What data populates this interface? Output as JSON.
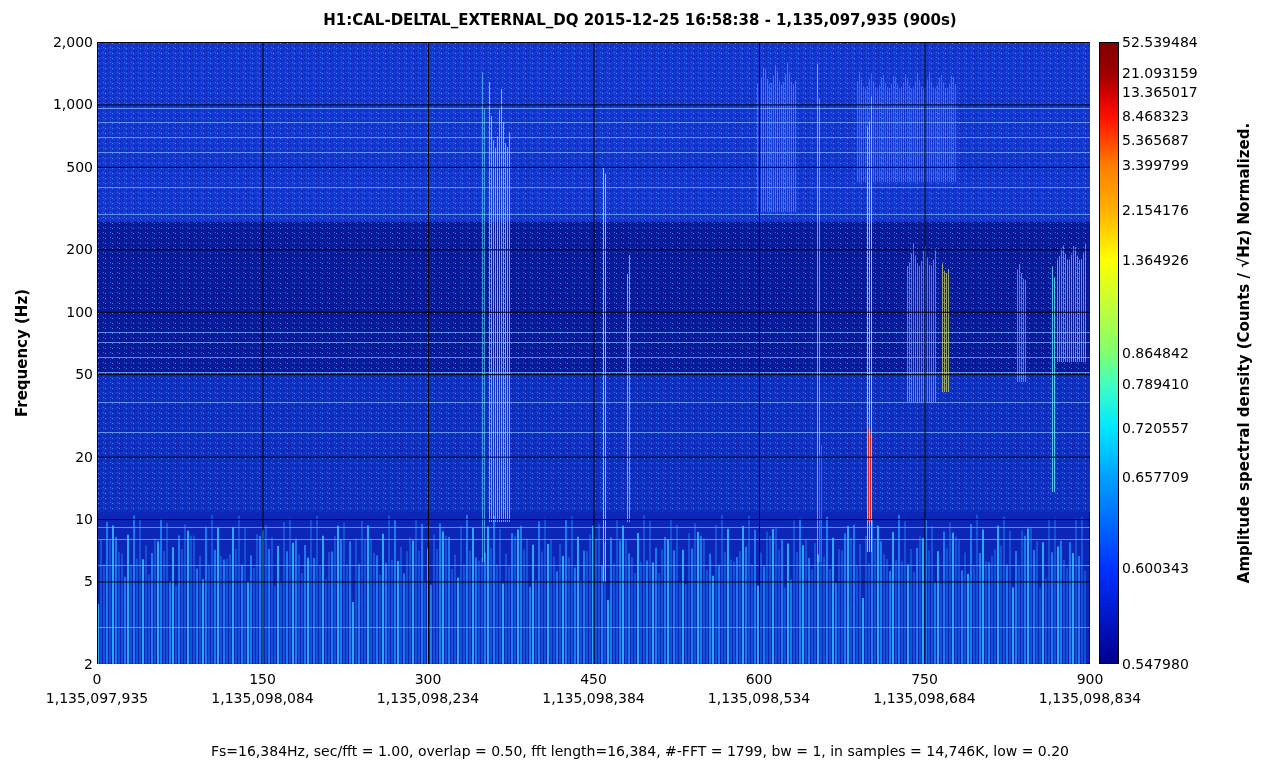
{
  "title": "H1:CAL-DELTAL_EXTERNAL_DQ 2015-12-25 16:58:38 - 1,135,097,935 (900s)",
  "y_axis": {
    "label": "Frequency (Hz)",
    "ticks": [
      "2,000",
      "1,000",
      "500",
      "200",
      "100",
      "50",
      "20",
      "10",
      "5",
      "2"
    ]
  },
  "x_axis": {
    "ticks": [
      {
        "label": "0",
        "time": "1,135,097,935"
      },
      {
        "label": "150",
        "time": "1,135,098,084"
      },
      {
        "label": "300",
        "time": "1,135,098,234"
      },
      {
        "label": "450",
        "time": "1,135,098,384"
      },
      {
        "label": "600",
        "time": "1,135,098,534"
      },
      {
        "label": "750",
        "time": "1,135,098,684"
      },
      {
        "label": "900",
        "time": "1,135,098,834"
      }
    ]
  },
  "colorbar": {
    "label": "Amplitude spectral density (Counts / √Hz) Normalized.",
    "ticks": [
      "52.539484",
      "21.093159",
      "13.365017",
      "8.468323",
      "5.365687",
      "3.399799",
      "2.154176",
      "1.364926",
      "0.864842",
      "0.789410",
      "0.720557",
      "0.657709",
      "0.600343",
      "0.547980"
    ]
  },
  "footer": "Fs=16,384Hz, sec/fft = 1.00, overlap = 0.50, fft length=16,384, #-FFT = 1799, bw = 1, in samples = 14,746K, low = 0.20"
}
